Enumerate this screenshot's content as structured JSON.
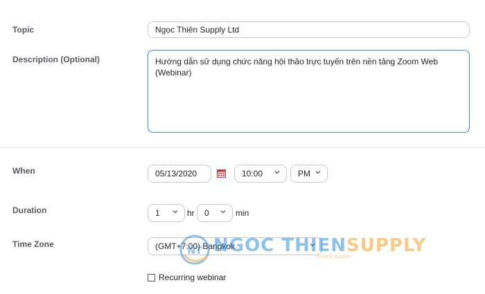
{
  "form": {
    "topic_label": "Topic",
    "topic_value": "Ngọc Thiên Supply Ltd",
    "description_label": "Description (Optional)",
    "description_value": "Hướng dẫn sử dụng chức năng hội thảo trực tuyến trên nền tảng Zoom Web (Webinar)",
    "when_label": "When",
    "date_value": "05/13/2020",
    "time_value": "10:00",
    "ampm_value": "PM",
    "duration_label": "Duration",
    "duration_hours": "1",
    "hours_unit": "hr",
    "duration_minutes": "0",
    "minutes_unit": "min",
    "timezone_label": "Time Zone",
    "timezone_value": "(GMT+7:00) Bangkok",
    "recurring_label": "Recurring webinar"
  },
  "watermark": {
    "logo_letters": "NT",
    "brand_part1": "NGOC THIEN",
    "brand_part2": "SUPPLY",
    "tagline": "Trusted Supplier"
  },
  "colors": {
    "focus_border": "#2d8cff",
    "field_border": "#c8c9ce",
    "label_text": "#555a66"
  }
}
